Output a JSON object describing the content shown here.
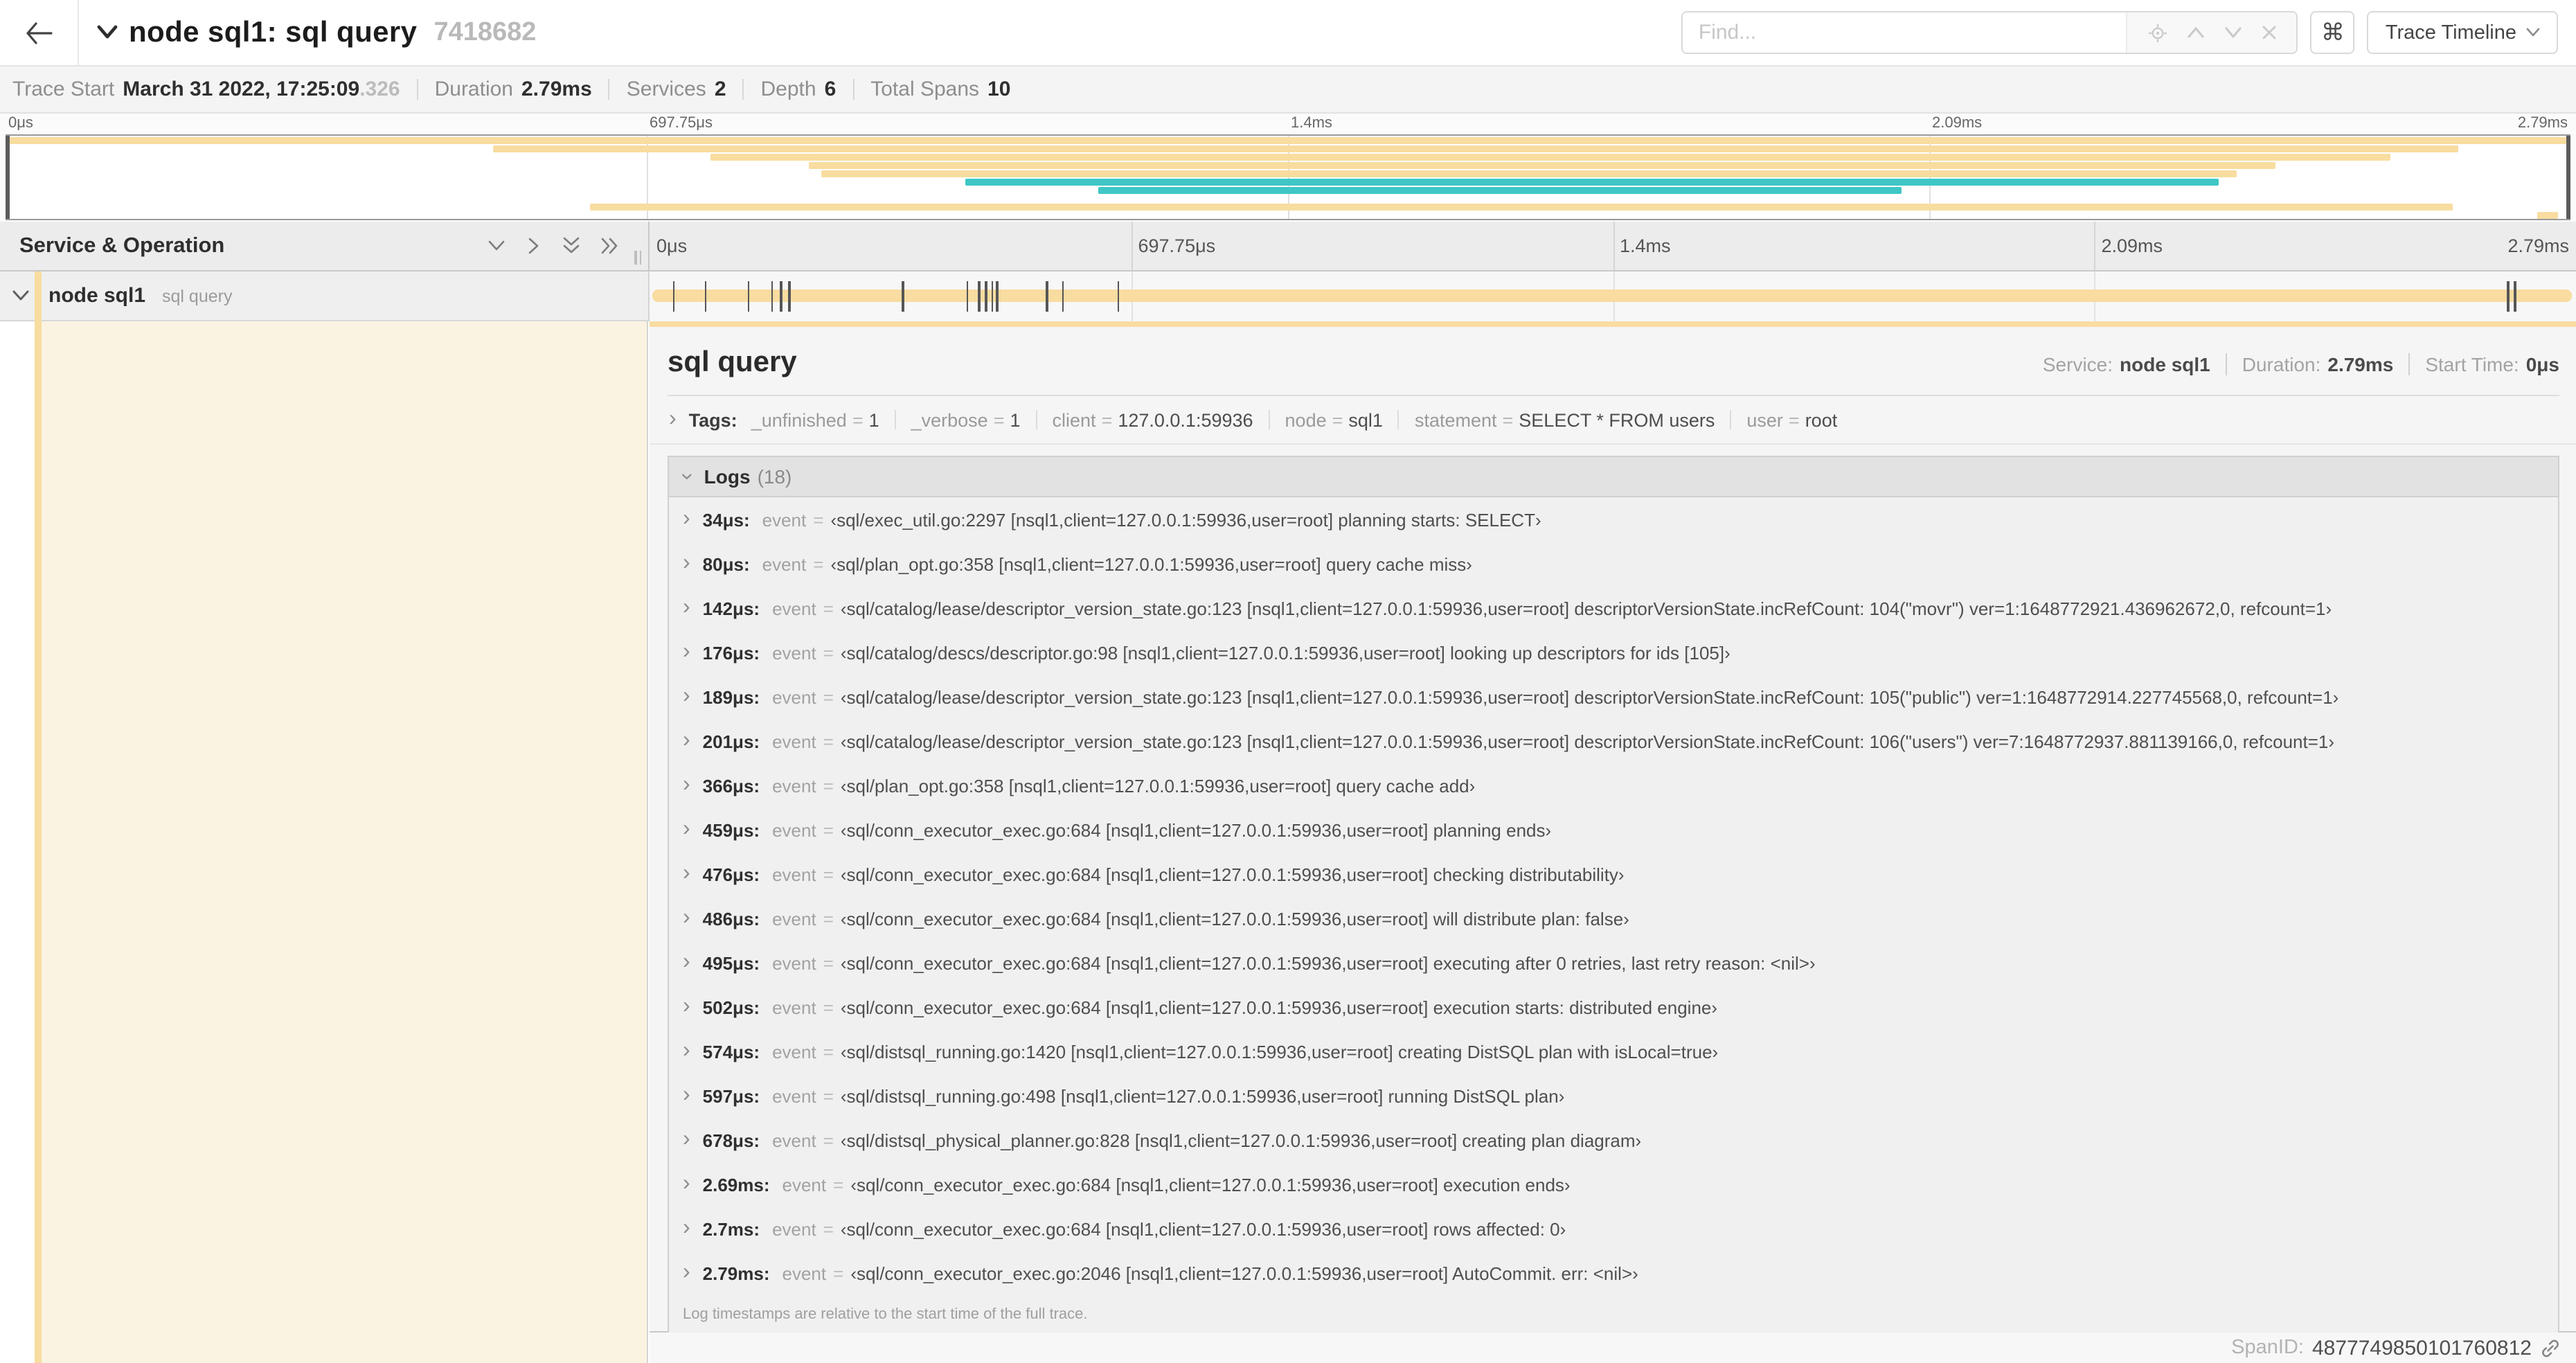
{
  "topbar": {
    "back_glyph": "←",
    "title": "node sql1: sql query",
    "trace_id": "7418682",
    "find_placeholder": "Find...",
    "kbd_glyph": "⌘",
    "view_button_label": "Trace Timeline"
  },
  "summary": {
    "items": [
      {
        "label": "Trace Start",
        "value": "March 31 2022, 17:25:09",
        "suffix": ".326"
      },
      {
        "label": "Duration",
        "value": "2.79ms",
        "suffix": ""
      },
      {
        "label": "Services",
        "value": "2",
        "suffix": ""
      },
      {
        "label": "Depth",
        "value": "6",
        "suffix": ""
      },
      {
        "label": "Total Spans",
        "value": "10",
        "suffix": ""
      }
    ]
  },
  "timeline": {
    "columns_header": "Service & Operation",
    "ticks": [
      "0μs",
      "697.75μs",
      "1.4ms",
      "2.09ms",
      "2.79ms"
    ],
    "tick_positions_pct": [
      0,
      25,
      50,
      75,
      100
    ],
    "total_us": 2790,
    "log_tick_times_us": [
      34,
      80,
      142,
      176,
      189,
      201,
      366,
      459,
      476,
      486,
      495,
      502,
      574,
      597,
      678,
      2690,
      2700,
      2790
    ],
    "minimap_spans": [
      {
        "row": 0,
        "start_pct": 0,
        "end_pct": 100,
        "color": "tan"
      },
      {
        "row": 1,
        "start_pct": 19,
        "end_pct": 95.6,
        "color": "tan"
      },
      {
        "row": 2,
        "start_pct": 27.5,
        "end_pct": 93,
        "color": "tan"
      },
      {
        "row": 3,
        "start_pct": 31.3,
        "end_pct": 88.5,
        "color": "tan"
      },
      {
        "row": 4,
        "start_pct": 31.8,
        "end_pct": 87,
        "color": "tan"
      },
      {
        "row": 5,
        "start_pct": 37.4,
        "end_pct": 86.3,
        "color": "teal"
      },
      {
        "row": 6,
        "start_pct": 42.6,
        "end_pct": 73.9,
        "color": "teal"
      },
      {
        "row": 8,
        "start_pct": 22.8,
        "end_pct": 95.4,
        "color": "tan"
      },
      {
        "row": 9,
        "start_pct": 98.7,
        "end_pct": 99.5,
        "color": "tan"
      }
    ]
  },
  "span_row": {
    "service": "node sql1",
    "operation": "sql query"
  },
  "detail": {
    "title": "sql query",
    "meta": [
      {
        "label": "Service:",
        "value": "node sql1"
      },
      {
        "label": "Duration:",
        "value": "2.79ms"
      },
      {
        "label": "Start Time:",
        "value": "0μs"
      }
    ],
    "tags_label": "Tags:",
    "tags": [
      {
        "key": "_unfinished",
        "value": "1"
      },
      {
        "key": "_verbose",
        "value": "1"
      },
      {
        "key": "client",
        "value": "127.0.0.1:59936"
      },
      {
        "key": "node",
        "value": "sql1"
      },
      {
        "key": "statement",
        "value": "SELECT * FROM users"
      },
      {
        "key": "user",
        "value": "root"
      }
    ],
    "logs_label": "Logs",
    "logs_count": "(18)",
    "logs": [
      {
        "ts": "34μs:",
        "key": "event",
        "value": "‹sql/exec_util.go:2297 [nsql1,client=127.0.0.1:59936,user=root] planning starts: SELECT›"
      },
      {
        "ts": "80μs:",
        "key": "event",
        "value": "‹sql/plan_opt.go:358 [nsql1,client=127.0.0.1:59936,user=root] query cache miss›"
      },
      {
        "ts": "142μs:",
        "key": "event",
        "value": "‹sql/catalog/lease/descriptor_version_state.go:123 [nsql1,client=127.0.0.1:59936,user=root] descriptorVersionState.incRefCount: 104(\"movr\") ver=1:1648772921.436962672,0, refcount=1›"
      },
      {
        "ts": "176μs:",
        "key": "event",
        "value": "‹sql/catalog/descs/descriptor.go:98 [nsql1,client=127.0.0.1:59936,user=root] looking up descriptors for ids [105]›"
      },
      {
        "ts": "189μs:",
        "key": "event",
        "value": "‹sql/catalog/lease/descriptor_version_state.go:123 [nsql1,client=127.0.0.1:59936,user=root] descriptorVersionState.incRefCount: 105(\"public\") ver=1:1648772914.227745568,0, refcount=1›"
      },
      {
        "ts": "201μs:",
        "key": "event",
        "value": "‹sql/catalog/lease/descriptor_version_state.go:123 [nsql1,client=127.0.0.1:59936,user=root] descriptorVersionState.incRefCount: 106(\"users\") ver=7:1648772937.881139166,0, refcount=1›"
      },
      {
        "ts": "366μs:",
        "key": "event",
        "value": "‹sql/plan_opt.go:358 [nsql1,client=127.0.0.1:59936,user=root] query cache add›"
      },
      {
        "ts": "459μs:",
        "key": "event",
        "value": "‹sql/conn_executor_exec.go:684 [nsql1,client=127.0.0.1:59936,user=root] planning ends›"
      },
      {
        "ts": "476μs:",
        "key": "event",
        "value": "‹sql/conn_executor_exec.go:684 [nsql1,client=127.0.0.1:59936,user=root] checking distributability›"
      },
      {
        "ts": "486μs:",
        "key": "event",
        "value": "‹sql/conn_executor_exec.go:684 [nsql1,client=127.0.0.1:59936,user=root] will distribute plan: false›"
      },
      {
        "ts": "495μs:",
        "key": "event",
        "value": "‹sql/conn_executor_exec.go:684 [nsql1,client=127.0.0.1:59936,user=root] executing after 0 retries, last retry reason: <nil>›"
      },
      {
        "ts": "502μs:",
        "key": "event",
        "value": "‹sql/conn_executor_exec.go:684 [nsql1,client=127.0.0.1:59936,user=root] execution starts: distributed engine›"
      },
      {
        "ts": "574μs:",
        "key": "event",
        "value": "‹sql/distsql_running.go:1420 [nsql1,client=127.0.0.1:59936,user=root] creating DistSQL plan with isLocal=true›"
      },
      {
        "ts": "597μs:",
        "key": "event",
        "value": "‹sql/distsql_running.go:498 [nsql1,client=127.0.0.1:59936,user=root] running DistSQL plan›"
      },
      {
        "ts": "678μs:",
        "key": "event",
        "value": "‹sql/distsql_physical_planner.go:828 [nsql1,client=127.0.0.1:59936,user=root] creating plan diagram›"
      },
      {
        "ts": "2.69ms:",
        "key": "event",
        "value": "‹sql/conn_executor_exec.go:684 [nsql1,client=127.0.0.1:59936,user=root] execution ends›"
      },
      {
        "ts": "2.7ms:",
        "key": "event",
        "value": "‹sql/conn_executor_exec.go:684 [nsql1,client=127.0.0.1:59936,user=root] rows affected: 0›"
      },
      {
        "ts": "2.79ms:",
        "key": "event",
        "value": "‹sql/conn_executor_exec.go:2046 [nsql1,client=127.0.0.1:59936,user=root] AutoCommit. err: <nil>›"
      }
    ],
    "footnote": "Log timestamps are relative to the start time of the full trace.",
    "spanid_label": "SpanID:",
    "spanid_value": "4877749850101760812"
  },
  "colors": {
    "span_tan": "#F8DCA0",
    "span_teal": "#3FC6C6",
    "detail_cream": "#FBF3E1"
  }
}
